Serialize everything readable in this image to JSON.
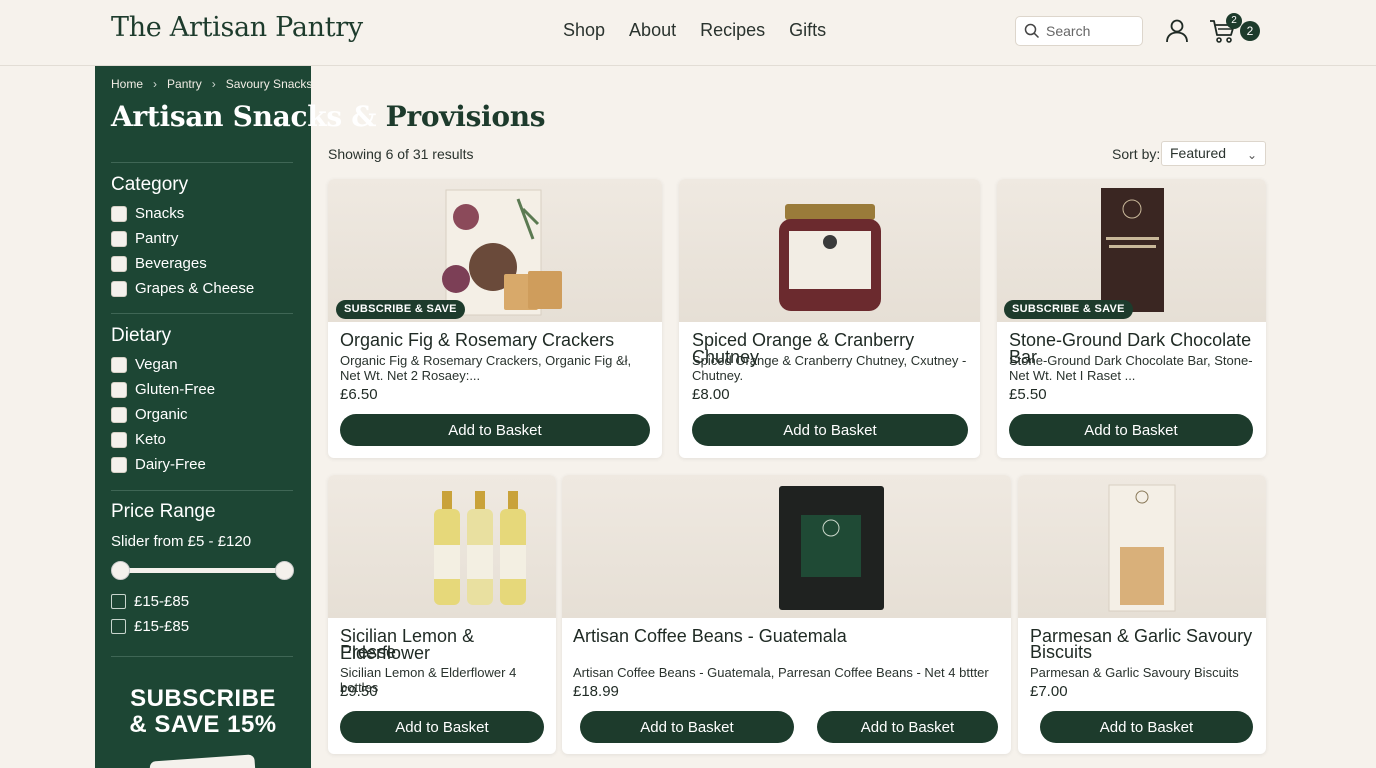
{
  "header": {
    "logo": "The Artisan Pantry",
    "nav": [
      "Shop",
      "About",
      "Recipes",
      "Gifts"
    ],
    "search_placeholder": "Search",
    "cart_count_small": "2",
    "cart_count": "2"
  },
  "breadcrumb": [
    "Home",
    "Pantry",
    "Savoury Snacks"
  ],
  "page_title_a": "Artisan Snacks &",
  "page_title_b": " Provisions",
  "filters": {
    "category_heading": "Category",
    "category": [
      "Snacks",
      "Pantry",
      "Beverages",
      "Grapes & Cheese"
    ],
    "dietary_heading": "Dietary",
    "dietary": [
      "Vegan",
      "Gluten-Free",
      "Organic",
      "Keto",
      "Dairy-Free"
    ],
    "price_heading": "Price Range",
    "slider_text": "Slider from £5 - £120",
    "price_options": [
      "£15-£85",
      "£15-£85"
    ]
  },
  "promo": {
    "line1": "SUBSCRIBE",
    "line2": "& SAVE 15%"
  },
  "results_text": "Showing 6 of 31 results",
  "sort": {
    "label": "Sort by:",
    "value": "Featured"
  },
  "products": [
    {
      "title": "Organic Fig & Rosemary Crackers",
      "desc1": "Organic Fig & Rosemary Crackers, Organic Fig &ł,",
      "desc2": "Net Wt. Net 2 Rosaey:...",
      "price": "£6.50",
      "badge": "SUBSCRIBE & SAVE",
      "button": "Add to Basket"
    },
    {
      "title": "Spiced Orange & Cranberry Chutney",
      "desc1": "Spiced Orange & Cranberry Chutney, Cxutney -",
      "desc2": "Chutney.",
      "price": "£8.00",
      "button": "Add to Basket"
    },
    {
      "title": "Stone-Ground Dark Chocolate Bar",
      "desc1": "Stone-Ground Dark Chocolate Bar, Stone-",
      "desc2": "Net Wt. Net I Raset ...",
      "price": "£5.50",
      "badge": "SUBSCRIBE & SAVE",
      "button": "Add to Basket"
    },
    {
      "title1": "Sicilian Lemon & Elderflower",
      "title2": "Presse",
      "desc1": "Sicilian Lemon & Elderflower 4 bottles",
      "price": "£9.50",
      "button": "Add to Basket"
    },
    {
      "title": "Artisan Coffee Beans - Guatemala",
      "desc1": "Artisan Coffee Beans - Guatemala, Parresan Coffee Beans -  Net 4 bttter",
      "price": "£18.99",
      "button": "Add to Basket",
      "button2": "Add to Basket"
    },
    {
      "title1": "Parmesan & Garlic Savoury",
      "title2": "Biscuits",
      "desc1": "Parmesan & Garlic Savoury Biscuits",
      "price": "£7.00",
      "button": "Add to Basket"
    }
  ],
  "colors": {
    "brand_green": "#1d3b2c",
    "sidebar_green": "#1d4634",
    "page_bg": "#f6f2ec"
  }
}
